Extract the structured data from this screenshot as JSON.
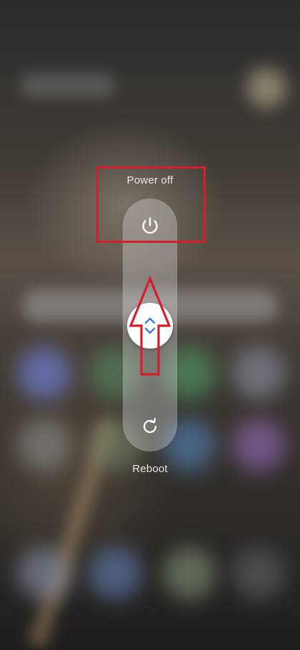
{
  "power_menu": {
    "power_off_label": "Power off",
    "reboot_label": "Reboot",
    "top_icon": "power-icon",
    "bottom_icon": "reboot-icon",
    "slider_icon": "up-down-chevrons-icon"
  },
  "annotations": {
    "highlight_color": "#d51e2b",
    "arrow_color": "#d51e2b"
  }
}
